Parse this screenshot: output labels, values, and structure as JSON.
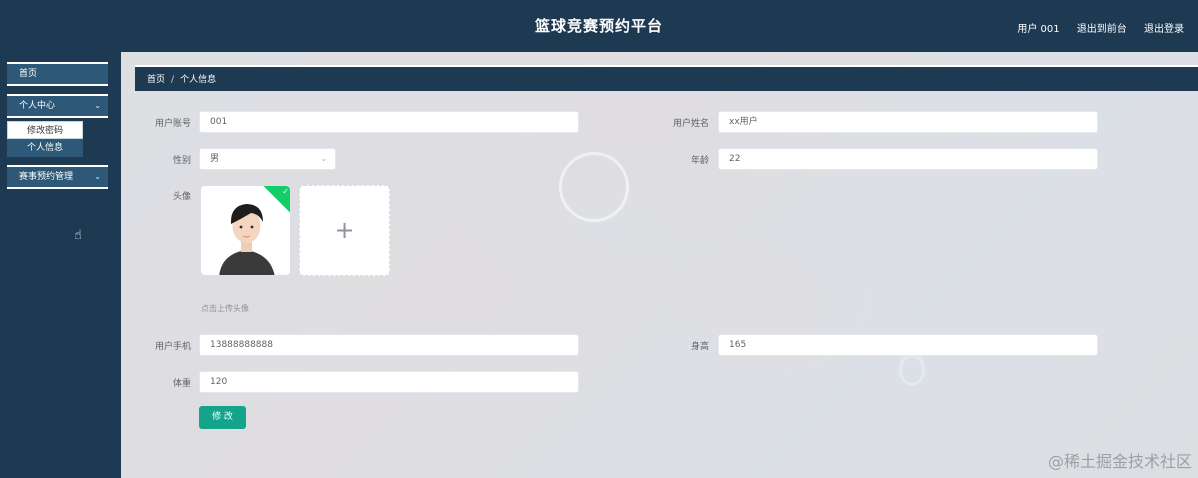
{
  "header": {
    "title": "篮球竞赛预约平台",
    "user": "用户 001",
    "back_frontend": "退出到前台",
    "logout": "退出登录"
  },
  "sidebar": {
    "items": [
      {
        "label": "首页"
      },
      {
        "label": "个人中心",
        "expanded": true,
        "children": [
          "修改密码",
          "个人信息"
        ]
      },
      {
        "label": "赛事预约管理",
        "expanded": false
      }
    ]
  },
  "breadcrumb": {
    "home": "首页",
    "separator": "/",
    "current": "个人信息"
  },
  "form": {
    "account": {
      "label": "用户账号",
      "value": "001"
    },
    "name": {
      "label": "用户姓名",
      "value": "xx用户"
    },
    "gender": {
      "label": "性别",
      "value": "男"
    },
    "age": {
      "label": "年龄",
      "value": "22"
    },
    "avatar": {
      "label": "头像",
      "hint": "点击上传头像",
      "upload_icon": "+"
    },
    "phone": {
      "label": "用户手机",
      "value": "13888888888"
    },
    "height": {
      "label": "身高",
      "value": "165"
    },
    "weight": {
      "label": "体重",
      "value": "120"
    },
    "submit": "修 改"
  },
  "watermark": "@稀土掘金技术社区",
  "colors": {
    "nav": "#1d3a52",
    "nav_item": "#2e5878",
    "accent": "#14a38b",
    "success": "#13ce66"
  }
}
